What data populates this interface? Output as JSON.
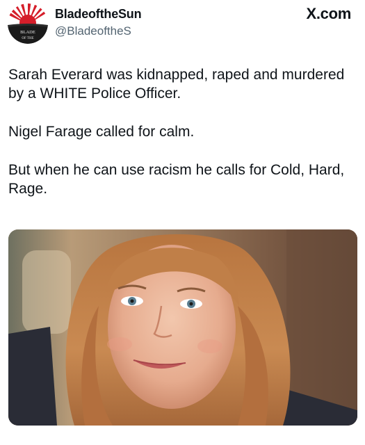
{
  "tweet": {
    "display_name": "BladeoftheSun",
    "handle": "@BladeoftheS",
    "platform": "X.com",
    "avatar_text": [
      "BLADE",
      "OF THE"
    ],
    "paragraphs": [
      "Sarah Everard was kidnapped, raped and murdered by a WHITE Police Officer.",
      "Nigel Farage called for calm.",
      "But when he can use racism he calls for Cold, Hard, Rage."
    ]
  },
  "icons": {
    "x_logo": "x-logo-icon",
    "avatar": "rising-sun-logo"
  },
  "colors": {
    "text": "#0f1419",
    "secondary_text": "#536471",
    "avatar_red": "#d51e2a"
  }
}
